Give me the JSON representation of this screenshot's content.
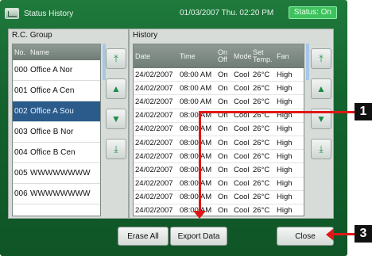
{
  "window": {
    "title": "Status History",
    "datetime": "01/03/2007 Thu. 02:20 PM",
    "status_badge": "Status: On"
  },
  "rc_group": {
    "title": "R.C. Group",
    "headers": [
      "No.",
      "Name"
    ],
    "rows": [
      {
        "no": "000",
        "name": "Office A Nor",
        "selected": false
      },
      {
        "no": "001",
        "name": "Office A Cen",
        "selected": false
      },
      {
        "no": "002",
        "name": "Office A Sou",
        "selected": true
      },
      {
        "no": "003",
        "name": "Office B Nor",
        "selected": false
      },
      {
        "no": "004",
        "name": "Office B Cen",
        "selected": false
      },
      {
        "no": "005",
        "name": "WWWWWWWW",
        "selected": false
      },
      {
        "no": "006",
        "name": "WWWWWWWW",
        "selected": false
      }
    ]
  },
  "history": {
    "title": "History",
    "headers": [
      "Date",
      "Time",
      "On Off",
      "Mode",
      "Set Temp.",
      "Fan"
    ],
    "rows": [
      [
        "24/02/2007",
        "08:00 AM",
        "On",
        "Cool",
        "26°C",
        "High"
      ],
      [
        "24/02/2007",
        "08:00 AM",
        "On",
        "Cool",
        "26°C",
        "High"
      ],
      [
        "24/02/2007",
        "08:00 AM",
        "On",
        "Cool",
        "26°C",
        "High"
      ],
      [
        "24/02/2007",
        "08:00 AM",
        "On",
        "Cool",
        "26°C",
        "High"
      ],
      [
        "24/02/2007",
        "08:00 AM",
        "On",
        "Cool",
        "26°C",
        "High"
      ],
      [
        "24/02/2007",
        "08:00 AM",
        "On",
        "Cool",
        "26°C",
        "High"
      ],
      [
        "24/02/2007",
        "08:00 AM",
        "On",
        "Cool",
        "26°C",
        "High"
      ],
      [
        "24/02/2007",
        "08:00 AM",
        "On",
        "Cool",
        "26°C",
        "High"
      ],
      [
        "24/02/2007",
        "08:00 AM",
        "On",
        "Cool",
        "26°C",
        "High"
      ],
      [
        "24/02/2007",
        "08:00 AM",
        "On",
        "Cool",
        "26°C",
        "High"
      ],
      [
        "24/02/2007",
        "08:00 AM",
        "On",
        "Cool",
        "26°C",
        "High"
      ]
    ]
  },
  "buttons": {
    "erase_all": "Erase All",
    "export_data": "Export Data",
    "close": "Close"
  },
  "callouts": {
    "one": "1",
    "three": "3"
  },
  "icons": {
    "nav_up_top": "⤒",
    "nav_up": "▲",
    "nav_down": "▼",
    "nav_down_bottom": "⤓"
  },
  "colors": {
    "background": "#14622d",
    "selection": "#2a5b8a",
    "status": "#3ec25d",
    "callout_arrow": "#e01717"
  }
}
